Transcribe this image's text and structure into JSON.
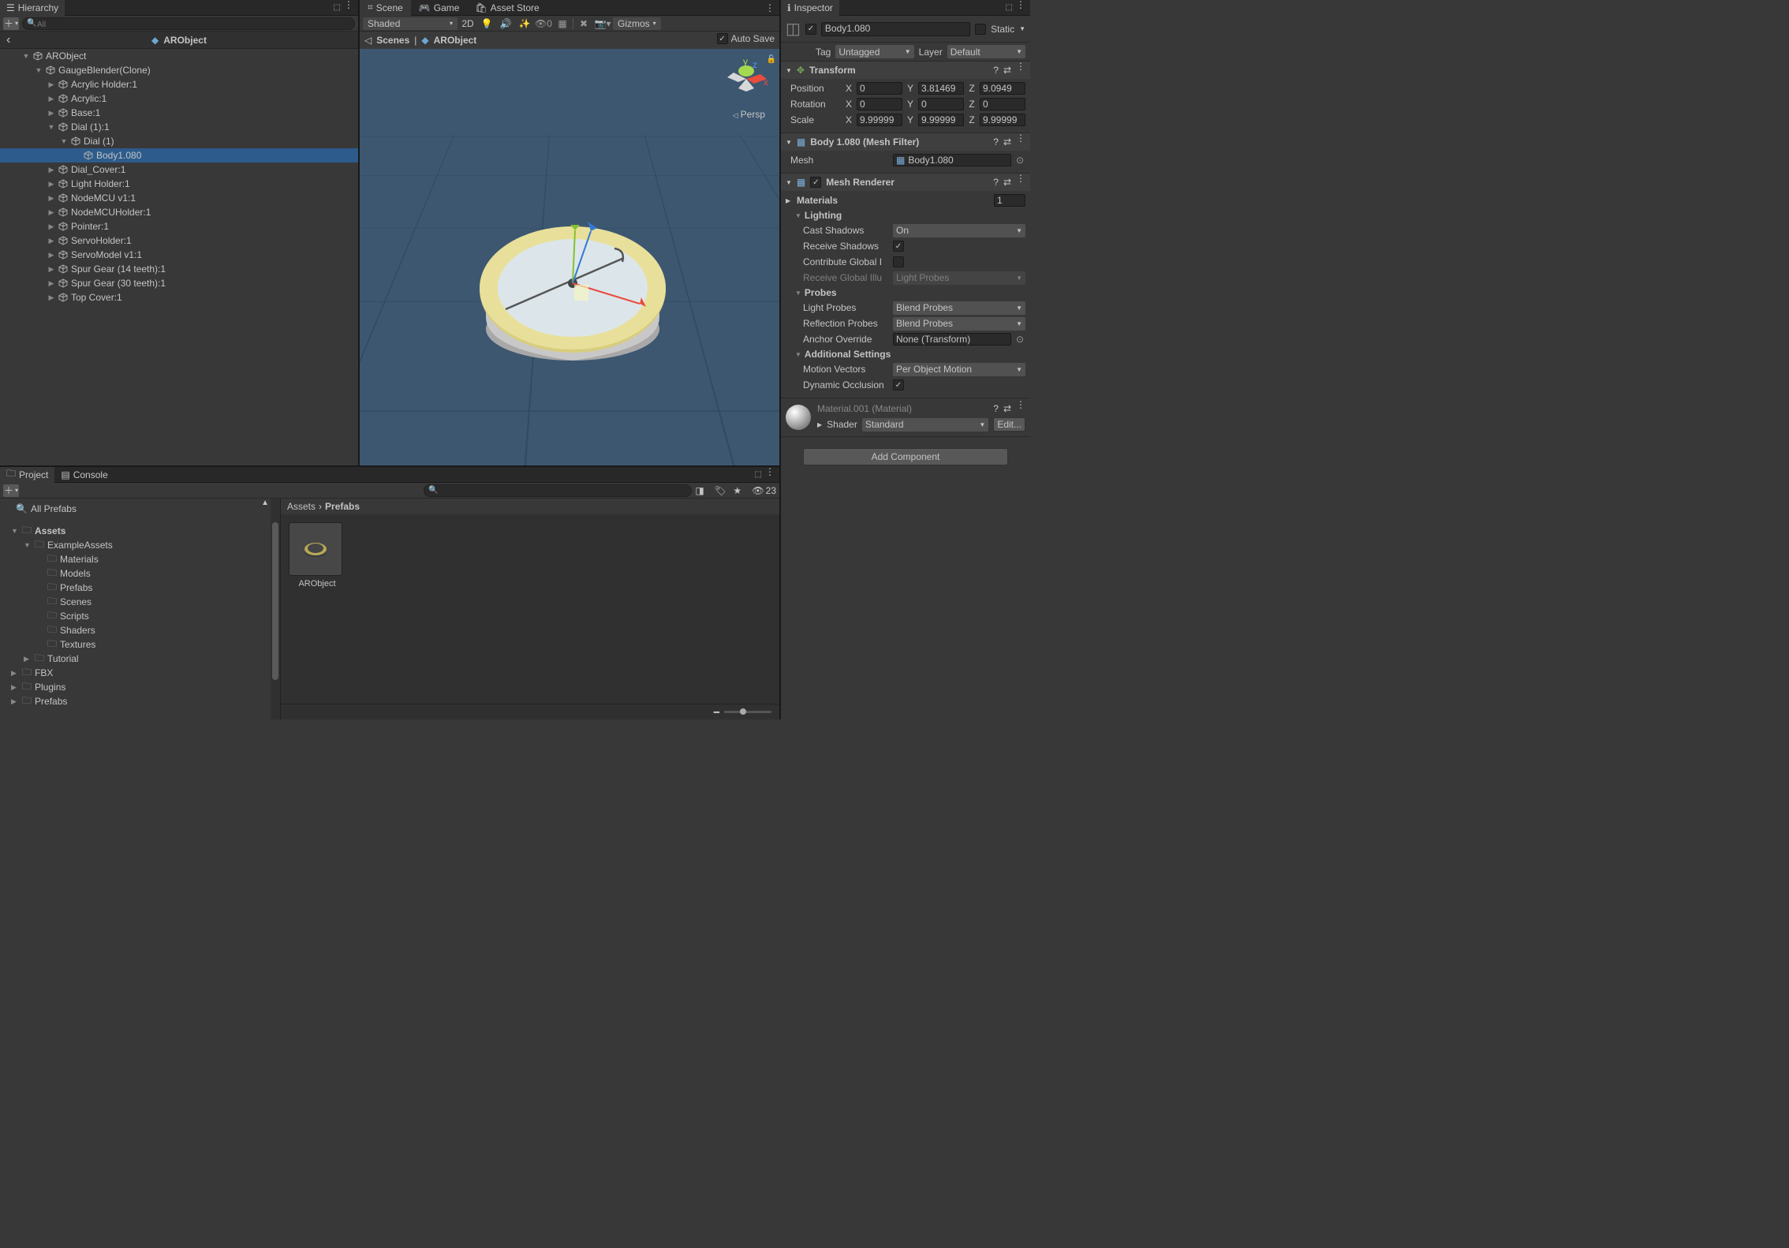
{
  "hierarchy": {
    "tab": "Hierarchy",
    "search_placeholder": "All",
    "prefab_context": "ARObject",
    "back_arrow": "‹",
    "tree": [
      {
        "d": 0,
        "f": "▼",
        "label": "ARObject"
      },
      {
        "d": 1,
        "f": "▼",
        "label": "GaugeBlender(Clone)"
      },
      {
        "d": 2,
        "f": "▶",
        "label": "Acrylic Holder:1"
      },
      {
        "d": 2,
        "f": "▶",
        "label": "Acrylic:1"
      },
      {
        "d": 2,
        "f": "▶",
        "label": "Base:1"
      },
      {
        "d": 2,
        "f": "▼",
        "label": "Dial (1):1"
      },
      {
        "d": 3,
        "f": "▼",
        "label": "Dial (1)"
      },
      {
        "d": 4,
        "f": "",
        "label": "Body1.080",
        "sel": true
      },
      {
        "d": 2,
        "f": "▶",
        "label": "Dial_Cover:1"
      },
      {
        "d": 2,
        "f": "▶",
        "label": "Light Holder:1"
      },
      {
        "d": 2,
        "f": "▶",
        "label": "NodeMCU v1:1"
      },
      {
        "d": 2,
        "f": "▶",
        "label": "NodeMCUHolder:1"
      },
      {
        "d": 2,
        "f": "▶",
        "label": "Pointer:1"
      },
      {
        "d": 2,
        "f": "▶",
        "label": "ServoHolder:1"
      },
      {
        "d": 2,
        "f": "▶",
        "label": "ServoModel v1:1"
      },
      {
        "d": 2,
        "f": "▶",
        "label": "Spur Gear (14 teeth):1"
      },
      {
        "d": 2,
        "f": "▶",
        "label": "Spur Gear (30 teeth):1"
      },
      {
        "d": 2,
        "f": "▶",
        "label": "Top Cover:1"
      }
    ]
  },
  "scene": {
    "tabs": {
      "scene": "Scene",
      "game": "Game",
      "asset": "Asset Store"
    },
    "shading": "Shaded",
    "mode_2d": "2D",
    "gizmos": "Gizmos",
    "breadcrumb_scenes": "Scenes",
    "breadcrumb_prefab": "ARObject",
    "autosave": "Auto Save",
    "persp": "Persp",
    "axes": {
      "x": "x",
      "y": "y",
      "z": "z"
    }
  },
  "project": {
    "tab_project": "Project",
    "tab_console": "Console",
    "hidden_count": "23",
    "favorites_all": "All Prefabs",
    "tree": [
      {
        "d": 0,
        "f": "▼",
        "label": "Assets",
        "bold": true
      },
      {
        "d": 1,
        "f": "▼",
        "label": "ExampleAssets"
      },
      {
        "d": 2,
        "f": "",
        "label": "Materials"
      },
      {
        "d": 2,
        "f": "",
        "label": "Models"
      },
      {
        "d": 2,
        "f": "",
        "label": "Prefabs"
      },
      {
        "d": 2,
        "f": "",
        "label": "Scenes"
      },
      {
        "d": 2,
        "f": "",
        "label": "Scripts"
      },
      {
        "d": 2,
        "f": "",
        "label": "Shaders"
      },
      {
        "d": 2,
        "f": "",
        "label": "Textures"
      },
      {
        "d": 1,
        "f": "▶",
        "label": "Tutorial"
      },
      {
        "d": 0,
        "f": "▶",
        "label": "FBX"
      },
      {
        "d": 0,
        "f": "▶",
        "label": "Plugins"
      },
      {
        "d": 0,
        "f": "▶",
        "label": "Prefabs"
      }
    ],
    "breadcrumb": [
      "Assets",
      "Prefabs"
    ],
    "asset_name": "ARObject"
  },
  "inspector": {
    "tab": "Inspector",
    "enabled": true,
    "name": "Body1.080",
    "static": "Static",
    "tag_label": "Tag",
    "tag_value": "Untagged",
    "layer_label": "Layer",
    "layer_value": "Default",
    "transform": {
      "title": "Transform",
      "position": {
        "label": "Position",
        "x": "0",
        "y": "3.81469",
        "z": "9.0949"
      },
      "rotation": {
        "label": "Rotation",
        "x": "0",
        "y": "0",
        "z": "0"
      },
      "scale": {
        "label": "Scale",
        "x": "9.99999",
        "y": "9.99999",
        "z": "9.99999"
      }
    },
    "mesh_filter": {
      "title": "Body 1.080 (Mesh Filter)",
      "mesh_label": "Mesh",
      "mesh_value": "Body1.080"
    },
    "mesh_renderer": {
      "title": "Mesh Renderer",
      "materials": "Materials",
      "materials_count": "1",
      "lighting": "Lighting",
      "cast_shadows_label": "Cast Shadows",
      "cast_shadows_value": "On",
      "receive_shadows": "Receive Shadows",
      "contribute_gi": "Contribute Global I",
      "receive_gi_label": "Receive Global Illu",
      "receive_gi_value": "Light Probes",
      "probes": "Probes",
      "light_probes_label": "Light Probes",
      "light_probes_value": "Blend Probes",
      "reflection_probes_label": "Reflection Probes",
      "reflection_probes_value": "Blend Probes",
      "anchor_label": "Anchor Override",
      "anchor_value": "None (Transform)",
      "additional": "Additional Settings",
      "motion_label": "Motion Vectors",
      "motion_value": "Per Object Motion",
      "dyn_occlusion": "Dynamic Occlusion"
    },
    "material": {
      "name": "Material.001 (Material)",
      "shader_label": "Shader",
      "shader_value": "Standard",
      "edit": "Edit..."
    },
    "add_component": "Add Component"
  }
}
